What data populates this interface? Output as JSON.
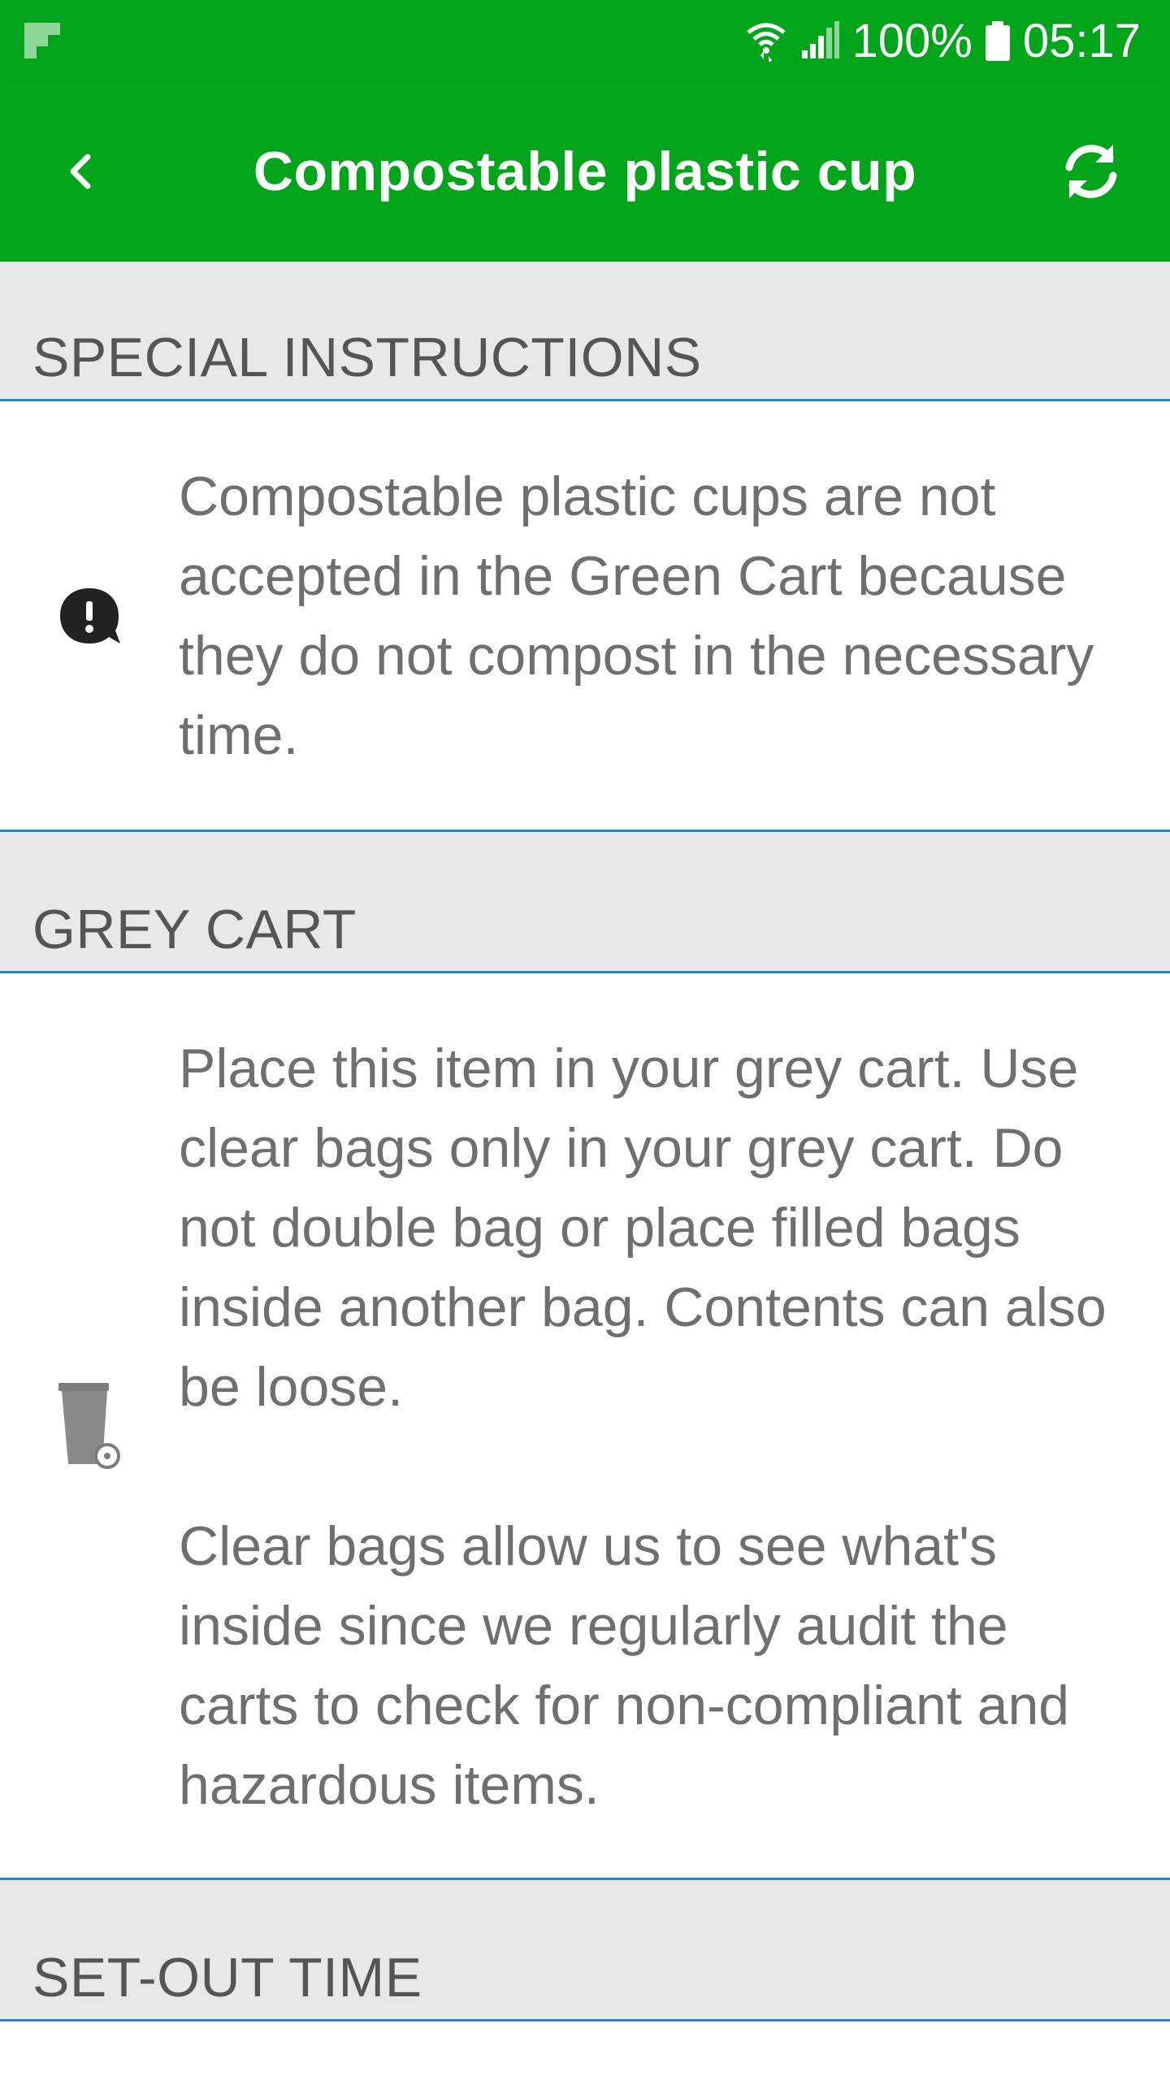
{
  "status_bar": {
    "notification_icon": "flipboard-f-icon",
    "wifi_icon": "wifi-icon",
    "signal_icon": "signal-icon",
    "battery_percent": "100%",
    "battery_icon": "battery-icon",
    "time": "05:17"
  },
  "toolbar": {
    "title": "Compostable plastic cup",
    "back_icon": "chevron-left-icon",
    "refresh_icon": "refresh-icon",
    "background_color": "#00a519"
  },
  "sections": {
    "special_instructions": {
      "header": "SPECIAL INSTRUCTIONS",
      "icon": "alert-speech-bubble-icon",
      "text": "Compostable plastic cups are not accepted in the Green Cart because they do not compost in the necessary time."
    },
    "grey_cart": {
      "header": "GREY CART",
      "icon": "grey-cart-icon",
      "paragraph_1": "Place this item in your grey cart. Use clear bags only in your grey cart. Do not double bag or place filled bags inside another bag. Contents can also be loose.",
      "paragraph_2": "Clear bags allow us to see what's inside since we regularly audit the carts to check for non-compliant and hazardous items."
    },
    "set_out_time": {
      "header": "SET-OUT TIME"
    }
  },
  "colors": {
    "accent_line": "#1e88c8",
    "header_bg": "#e8e8e8",
    "text": "#6f6f6f"
  }
}
